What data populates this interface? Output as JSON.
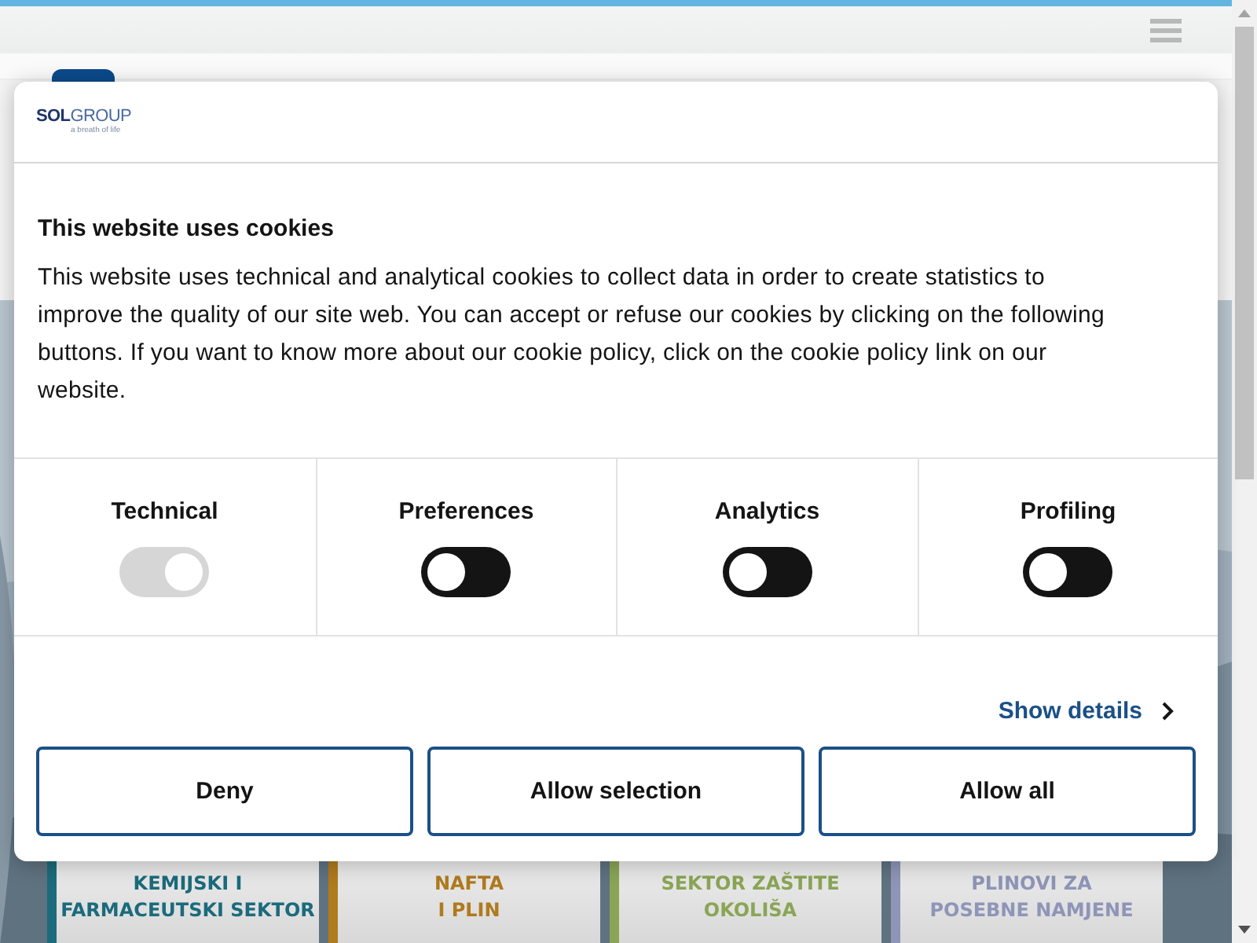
{
  "logo": {
    "name_bold": "SOL",
    "name_light": "GROUP",
    "tagline": "a breath of life"
  },
  "dialog": {
    "title": "This website uses cookies",
    "text": "This website uses technical and analytical cookies to collect data in order to create statistics to improve the quality of our site web. You can accept or refuse our cookies by clicking on the following buttons. If you want to know more about our cookie policy, click on the cookie policy link on our website.",
    "toggles": [
      {
        "label": "Technical",
        "on": true,
        "disabled": true
      },
      {
        "label": "Preferences",
        "on": false,
        "disabled": false
      },
      {
        "label": "Analytics",
        "on": false,
        "disabled": false
      },
      {
        "label": "Profiling",
        "on": false,
        "disabled": false
      }
    ],
    "details_link": "Show details",
    "buttons": [
      "Deny",
      "Allow selection",
      "Allow all"
    ]
  },
  "cards": [
    {
      "lines": [
        "KEMIJSKI I",
        "FARMACEUTSKI SEKTOR"
      ],
      "color": "#1b6b7c"
    },
    {
      "lines": [
        "NAFTA",
        "I PLIN"
      ],
      "color": "#b07a1e"
    },
    {
      "lines": [
        "SEKTOR ZAŠTITE",
        "OKOLIŠA"
      ],
      "color": "#8aa556"
    },
    {
      "lines": [
        "PLINOVI ZA",
        "POSEBNE NAMJENE"
      ],
      "color": "#8f95b8"
    }
  ]
}
